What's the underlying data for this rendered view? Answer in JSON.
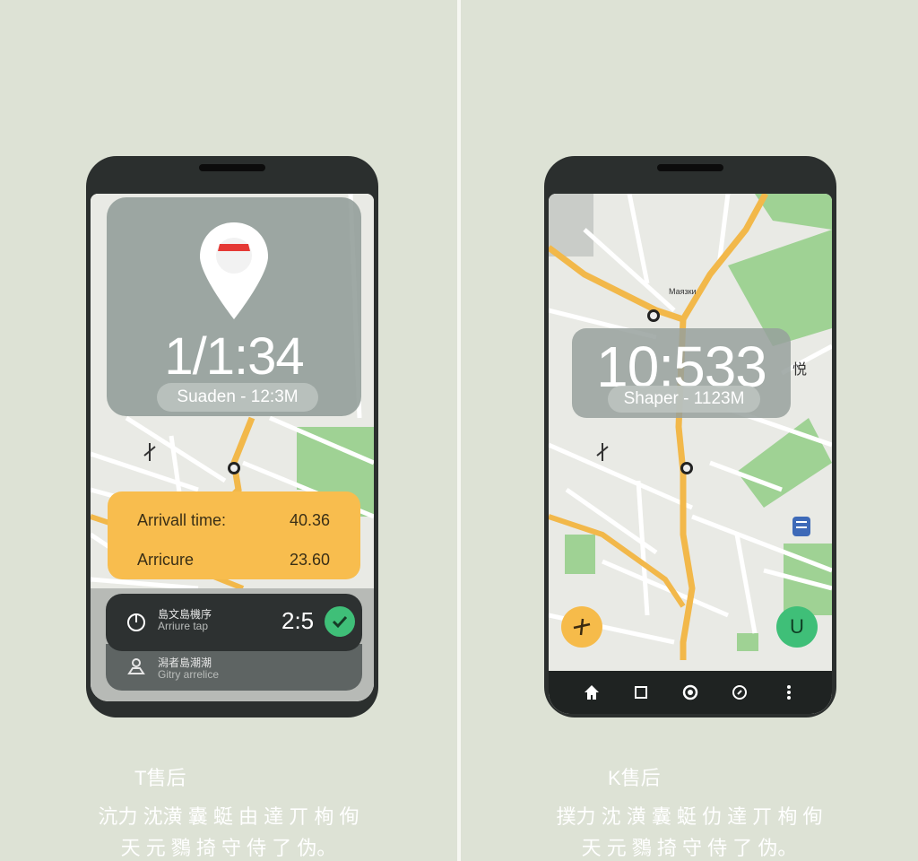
{
  "left_phone": {
    "time": "1/1:34",
    "subtitle": "Suaden - 12:3M",
    "info_card": {
      "row1_label": "Arrivall time:",
      "row1_value": "40.36",
      "row2_label": "Arricure",
      "row2_value": "23.60"
    },
    "card1": {
      "title": "島文島機序",
      "subtitle": "Arriure tap",
      "count": "2:5",
      "icon": "power-icon",
      "action_icon": "check-icon"
    },
    "card2": {
      "title": "潟者島潮潮",
      "subtitle": "Gitry arrelice",
      "icon": "person-pin-icon"
    },
    "pin_icon": "location-pin-icon",
    "pin_accent": "#e53935"
  },
  "right_phone": {
    "time": "10:533",
    "subtitle": "Shaper - 1123M",
    "map_label_1": "Маязки",
    "map_label_2": "悦",
    "fab_left_icon": "navigation-icon",
    "fab_right_label": "U",
    "navbar": [
      "home-icon",
      "square-icon",
      "circle-icon",
      "compass-icon",
      "more-vert-icon"
    ]
  },
  "captions": {
    "left_title": "T售后",
    "left_line1": "沆力 沈潢 囊 蜓 由 達 丌 栒 侚",
    "left_line2": "天 元 鷚 掎 守 侍 了 伪。",
    "right_title": "K售后",
    "right_line1": "撲力 沈 潢 囊 蜓 仂 達 丌 栒 侚",
    "right_line2": "天 元 鷚 掎 守 侍 了 伪。"
  },
  "colors": {
    "accent_orange": "#f6bb4a",
    "accent_green": "#3fbf78",
    "road_yellow": "#f2b84a",
    "park_green": "#9fd294",
    "background": "#dde2d5"
  }
}
